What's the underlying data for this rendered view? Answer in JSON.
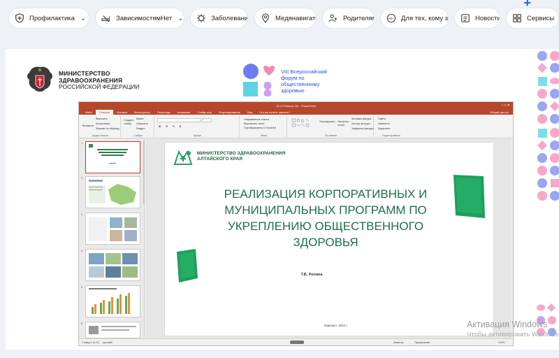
{
  "nav": {
    "items": [
      {
        "label": "Профилактика",
        "has_dropdown": true,
        "icon": "shield-icon"
      },
      {
        "label": "ЗависимостямНет",
        "has_dropdown": true,
        "icon": "no-smoking-icon"
      },
      {
        "label": "Заболевания",
        "has_dropdown": false,
        "icon": "virus-icon"
      },
      {
        "label": "Медянавигатор",
        "has_dropdown": false,
        "icon": "location-pin-icon"
      },
      {
        "label": "Родителям",
        "has_dropdown": false,
        "icon": "parents-icon"
      },
      {
        "label": "Для тех, кому за...",
        "has_dropdown": false,
        "icon": "age-badge-icon"
      },
      {
        "label": "Новости",
        "has_dropdown": false,
        "icon": "news-icon"
      },
      {
        "label": "Сервисы",
        "has_dropdown": false,
        "icon": "services-icon"
      }
    ]
  },
  "header": {
    "ministry_line1": "МИНИСТЕРСТВО",
    "ministry_line2": "ЗДРАВООХРАНЕНИЯ",
    "ministry_line3": "РОССИЙСКОЙ ФЕДЕРАЦИИ",
    "forum_line1": "VIII Всероссийский",
    "forum_line2": "форум по",
    "forum_line3": "общественному",
    "forum_line4": "здоровью"
  },
  "ppt": {
    "window_title": "15.12 Репина Т.В. · PowerPoint",
    "tabs": [
      "Файл",
      "Главная",
      "Вставка",
      "Конструктор",
      "Переходы",
      "Анимация",
      "Слайд-шоу",
      "Рецензирование",
      "Вид"
    ],
    "active_tab": "Главная",
    "search_tab": "Что вы хотите сделать?",
    "share_label": "Общий доступ",
    "ribbon": {
      "paste": "Вставить",
      "cut": "Вырезать",
      "copy": "Копировать",
      "format_painter": "Формат по образцу",
      "clipboard_group": "Буфер обмена",
      "new_slide": "Создать слайд",
      "layout": "Макет",
      "reset": "Сбросить",
      "section": "Раздел",
      "slides_group": "Слайды",
      "font_group": "Шрифт",
      "paragraph_group": "Абзац",
      "text_direction": "Направление текста",
      "align_text": "Выровнять текст",
      "smartart": "Преобразовать в SmartArt",
      "drawing_group": "Рисование",
      "arrange": "Упорядочить",
      "quick_styles": "Экспресс-стили",
      "shape_fill": "Заливка фигуры",
      "shape_outline": "Контур фигуры",
      "shape_effects": "Эффекты фигуры",
      "find": "Найти",
      "replace": "Заменить",
      "select": "Выделить",
      "editing_group": "Редактирование"
    },
    "slide": {
      "ministry_line1": "МИНИСТЕРСТВО ЗДРАВООХРАНЕНИЯ",
      "ministry_line2": "АЛТАЙСКОГО КРАЯ",
      "title_line1": "РЕАЛИЗАЦИЯ КОРПОРАТИВНЫХ И",
      "title_line2": "МУНИЦИПАЛЬНЫХ ПРОГРАММ ПО",
      "title_line3": "УКРЕПЛЕНИЮ ОБЩЕСТВЕННОГО",
      "title_line4": "ЗДОРОВЬЯ",
      "author": "Т.В. Репина",
      "footer": "Барнаул, 2024 г."
    },
    "thumb_numbers": [
      "1",
      "2",
      "3",
      "4",
      "5",
      "6"
    ],
    "status": {
      "slide_counter": "Слайд 1 из 15",
      "language": "русский",
      "notes": "Заметки",
      "comments": "Примечания",
      "zoom": "119%"
    }
  },
  "watermark": {
    "line1": "Активация Windows",
    "line2": "Чтобы активировать Windows"
  },
  "colors": {
    "accent_blue": "#1e63e9",
    "ppt_red": "#b7472a",
    "slide_green": "#1f6e45",
    "decor_pink": "#f7a8c8",
    "decor_blue": "#9aa6f0",
    "decor_teal": "#7fdde6"
  }
}
